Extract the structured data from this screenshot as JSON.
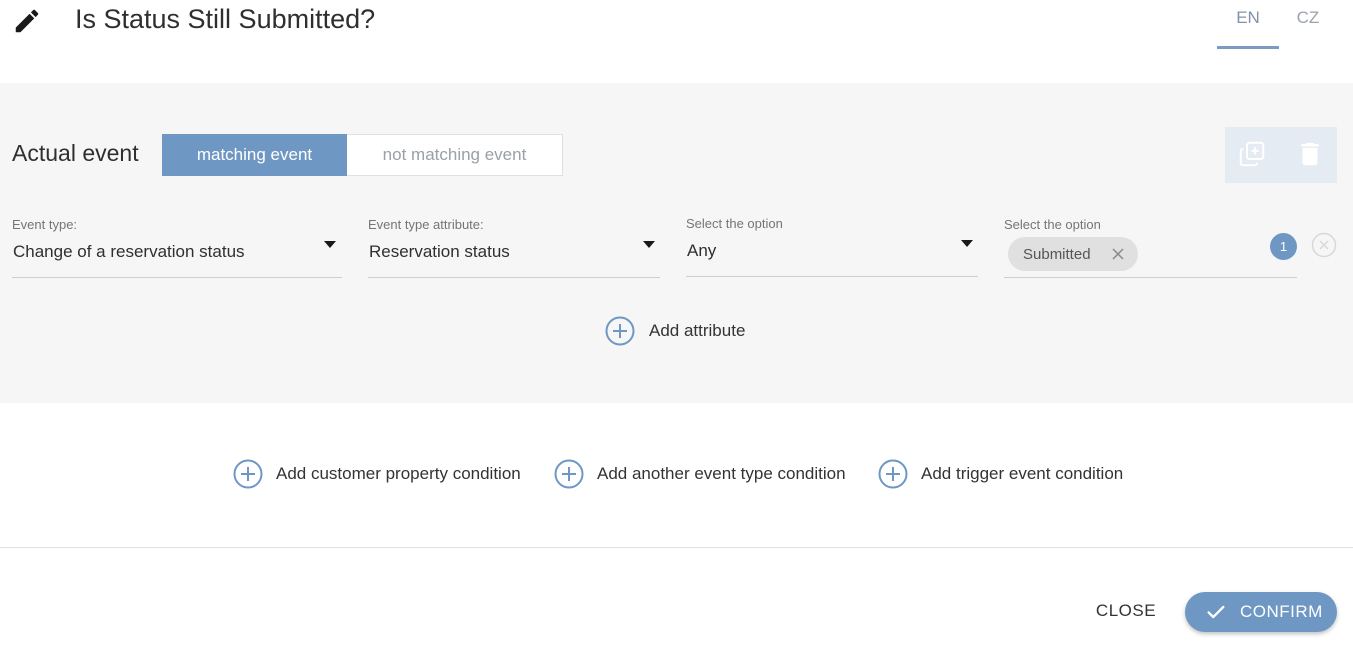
{
  "header": {
    "title": "Is Status Still Submitted?",
    "edit_icon": "pencil-icon",
    "languages": [
      {
        "label": "EN",
        "active": true
      },
      {
        "label": "CZ",
        "active": false
      }
    ]
  },
  "event_panel": {
    "label": "Actual event",
    "toggle": {
      "matching_label": "matching event",
      "not_matching_label": "not matching event",
      "selected": "matching event"
    },
    "actions": {
      "duplicate_icon": "duplicate-icon",
      "delete_icon": "trash-icon"
    },
    "fields": {
      "event_type": {
        "label": "Event type:",
        "value": "Change of a reservation status"
      },
      "event_type_attribute": {
        "label": "Event type attribute:",
        "value": "Reservation status"
      },
      "operator": {
        "label": "Select the option",
        "value": "Any"
      },
      "values": {
        "label": "Select the option",
        "chips": [
          "Submitted"
        ],
        "count": "1"
      }
    },
    "add_attribute_label": "Add attribute"
  },
  "conditions": {
    "customer_property_label": "Add customer property condition",
    "event_type_label": "Add another event type condition",
    "trigger_event_label": "Add trigger event condition"
  },
  "footer": {
    "close_label": "CLOSE",
    "confirm_label": "CONFIRM"
  },
  "colors": {
    "accent": "#6e97c4",
    "panel_bg": "#f6f6f6",
    "action_box_bg": "#e4ebf2"
  }
}
